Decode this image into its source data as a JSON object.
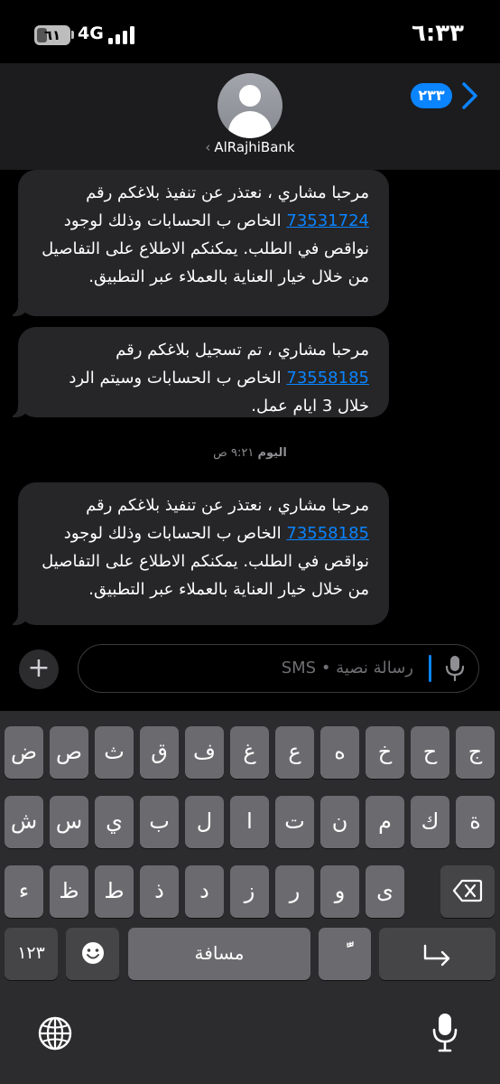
{
  "status_bar": {
    "time": "٦:٣٣",
    "network": "4G",
    "battery_level": "٦١"
  },
  "header": {
    "contact_name": "AlRajhiBank",
    "unread_badge": "٢٣٣"
  },
  "messages": [
    {
      "pre": "مرحبا مشاري ، نعتذر عن تنفيذ بلاغكم رقم ",
      "link": "73531724",
      "post": " الخاص ب الحسابات وذلك لوجود نواقص في الطلب. يمكنكم الاطلاع على التفاصيل من خلال خيار العناية بالعملاء عبر التطبيق."
    },
    {
      "pre": "مرحبا مشاري ، تم تسجيل بلاغكم رقم ",
      "link": "73558185",
      "post": " الخاص ب الحسابات وسيتم الرد خلال 3 ايام عمل."
    },
    {
      "pre": "مرحبا مشاري ، نعتذر عن تنفيذ بلاغكم رقم ",
      "link": "73558185",
      "post": " الخاص ب الحسابات وذلك لوجود نواقص في الطلب. يمكنكم الاطلاع على التفاصيل من خلال خيار العناية بالعملاء عبر التطبيق."
    }
  ],
  "timestamp": {
    "day": "اليوم",
    "time": "٩:٢١ ص"
  },
  "compose": {
    "placeholder": "رسالة نصية • SMS"
  },
  "keyboard": {
    "row1": [
      "ض",
      "ص",
      "ث",
      "ق",
      "ف",
      "غ",
      "ع",
      "ه",
      "خ",
      "ح",
      "ج"
    ],
    "row2": [
      "ش",
      "س",
      "ي",
      "ب",
      "ل",
      "ا",
      "ت",
      "ن",
      "م",
      "ك",
      "ة"
    ],
    "row3": [
      "ء",
      "ظ",
      "ط",
      "ذ",
      "د",
      "ز",
      "ر",
      "و",
      "ى"
    ],
    "numbers_label": "١٢٣",
    "space_label": "مسافة",
    "tanween_label": "ًّ"
  },
  "colors": {
    "accent": "#0a84ff",
    "bubble": "#262628",
    "keyboard_bg": "#2c2c2e",
    "key": "#6b6b6f"
  }
}
